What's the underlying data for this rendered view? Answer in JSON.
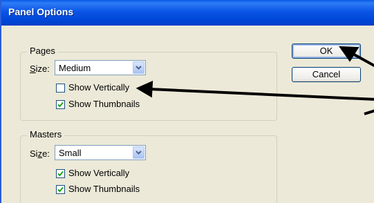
{
  "dialog": {
    "title": "Panel Options"
  },
  "pages": {
    "group_label": "Pages",
    "size_label_first": "S",
    "size_label_rest": "ize:",
    "size_value": "Medium",
    "show_vertically": {
      "label": "Show Vertically",
      "checked": false
    },
    "show_thumbnails": {
      "label": "Show Thumbnails",
      "checked": true
    }
  },
  "masters": {
    "group_label": "Masters",
    "size_label_first": "Si",
    "size_label_underlined": "z",
    "size_label_rest": "e:",
    "size_value": "Small",
    "show_vertically": {
      "label": "Show Vertically",
      "checked": true
    },
    "show_thumbnails": {
      "label": "Show Thumbnails",
      "checked": true
    }
  },
  "buttons": {
    "ok": "OK",
    "cancel": "Cancel"
  },
  "colors": {
    "titlebar": "#0054e3",
    "dialog_bg": "#ece9d8",
    "annotation_arrow": "#000000"
  }
}
